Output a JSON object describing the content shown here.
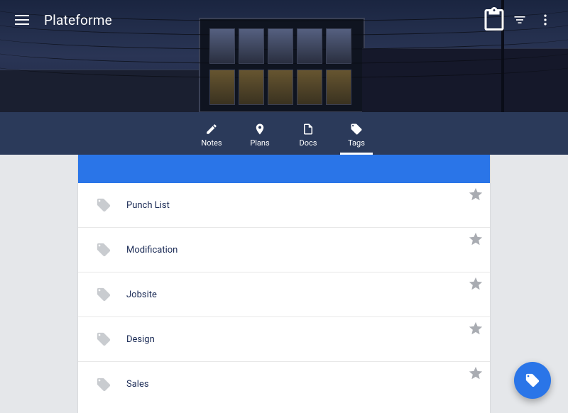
{
  "app": {
    "title": "Plateforme"
  },
  "tabs": {
    "notes": "Notes",
    "plans": "Plans",
    "docs": "Docs",
    "tags": "Tags",
    "active": "tags"
  },
  "tags_list": [
    {
      "label": "Punch List"
    },
    {
      "label": "Modification"
    },
    {
      "label": "Jobsite"
    },
    {
      "label": "Design"
    },
    {
      "label": "Sales"
    }
  ],
  "colors": {
    "accent": "#2a75e8",
    "tabbar": "#2b3a5a"
  }
}
